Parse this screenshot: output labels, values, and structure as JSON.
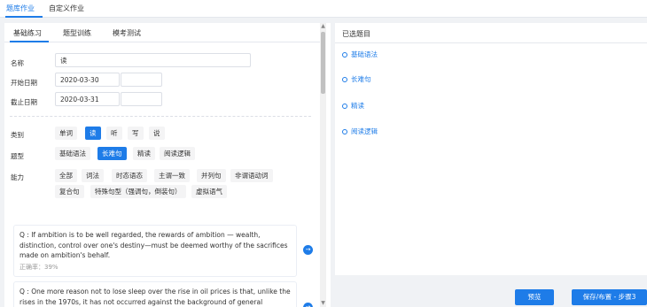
{
  "top_tabs": [
    {
      "label": "题库作业",
      "active": true
    },
    {
      "label": "自定义作业",
      "active": false
    }
  ],
  "sub_tabs": [
    {
      "label": "基础练习",
      "active": true
    },
    {
      "label": "题型训练",
      "active": false
    },
    {
      "label": "模考测试",
      "active": false
    }
  ],
  "form": {
    "name_label": "名称",
    "name_value": "读",
    "start_label": "开始日期",
    "start_date": "2020-03-30",
    "start_time": "",
    "end_label": "截止日期",
    "end_date": "2020-03-31",
    "end_time": ""
  },
  "filters": {
    "category_label": "类别",
    "categories": [
      {
        "label": "单词",
        "selected": false
      },
      {
        "label": "读",
        "selected": true
      },
      {
        "label": "听",
        "selected": false
      },
      {
        "label": "写",
        "selected": false
      },
      {
        "label": "说",
        "selected": false
      }
    ],
    "type_label": "题型",
    "types": [
      {
        "label": "基础语法",
        "selected": false
      },
      {
        "label": "长难句",
        "selected": true
      },
      {
        "label": "精读",
        "selected": false
      },
      {
        "label": "阅读逻辑",
        "selected": false
      }
    ],
    "ability_label": "能力",
    "abilities_row1": [
      "全部",
      "词法",
      "时态语态",
      "主谓一致",
      "并列句",
      "非谓语动词"
    ],
    "abilities_row2": [
      "复合句",
      "特殊句型（强调句，倒装句）",
      "虚拟语气"
    ]
  },
  "questions": [
    {
      "text": "Q : If ambition is to be well regarded, the rewards of ambition — wealth, distinction, control over one's destiny—must be deemed worthy of the sacrifices made on ambition's behalf.",
      "rate": "正确率：39%"
    },
    {
      "text": "Q : One more reason not to lose sleep over the rise in oil prices is that, unlike the rises in the 1970s, it has not occurred against the background of general commodity-",
      "rate": ""
    }
  ],
  "selected_panel": {
    "title": "已选题目",
    "items": [
      "基础语法",
      "长难句",
      "精读",
      "阅读逻辑"
    ]
  },
  "buttons": {
    "preview": "预览",
    "save": "保存/布置 - 步骤3"
  },
  "colors": {
    "accent": "#1e7ce8",
    "chip_bg": "#f4f4f5"
  },
  "icons": {
    "question_action": "arrow-right-circle-icon",
    "selected_marker": "circle-outline-icon"
  }
}
